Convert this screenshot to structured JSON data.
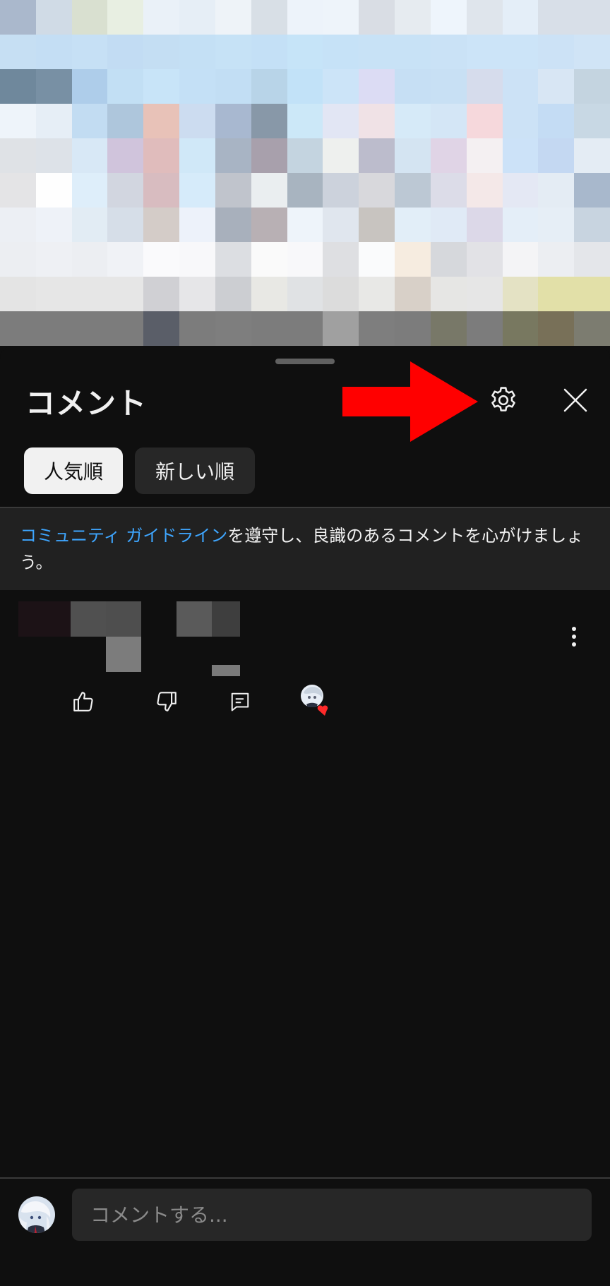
{
  "video": {
    "pixel_colors": [
      [
        "#aab8cc",
        "#d0dbe6",
        "#d9e0d0",
        "#e8efe2",
        "#eaf1f8",
        "#e6eef6",
        "#eef3f8",
        "#d8dfe6",
        "#edf3fa",
        "#eef4fa",
        "#d9dde4",
        "#e6ebf0",
        "#eef5fc",
        "#dfe5ec",
        "#e4eef8",
        "#d8dfe8",
        "#d8dfe8"
      ],
      [
        "#c6dff3",
        "#c4def4",
        "#c6e0f5",
        "#c2dcf3",
        "#c4def3",
        "#c4e0f5",
        "#c6e2f6",
        "#c4e0f6",
        "#c6e4f8",
        "#c6e2f7",
        "#c8e2f6",
        "#c8e2f6",
        "#cae2f6",
        "#cce4f8",
        "#cce4f8",
        "#cce2f6",
        "#d0e4f6"
      ],
      [
        "#6f889c",
        "#7890a4",
        "#aecdea",
        "#c2dff4",
        "#c8e4f8",
        "#c4e0f6",
        "#c2def4",
        "#b8d4e8",
        "#c2e2f8",
        "#cce4f8",
        "#dcdcf4",
        "#c6dff4",
        "#c8e0f4",
        "#d6dcec",
        "#cce2f6",
        "#d8e6f4",
        "#c4d4e0"
      ],
      [
        "#eef4fa",
        "#e6eef6",
        "#c2dcf2",
        "#aec6dc",
        "#e8c2b8",
        "#ccdcf0",
        "#a8b8d0",
        "#8898a8",
        "#cce8f8",
        "#e2e6f4",
        "#f0e2e6",
        "#d6eaf8",
        "#d4e6f6",
        "#f6d8dc",
        "#cce2f6",
        "#c4dcf4",
        "#c8d8e4"
      ],
      [
        "#dfe2e6",
        "#dde2e8",
        "#d8e8f6",
        "#d0c4dc",
        "#e0bcbc",
        "#d0e8f8",
        "#a8b4c4",
        "#a8a0ac",
        "#c4d4e0",
        "#eef0ee",
        "#bcbccc",
        "#d4e4f2",
        "#e0d4e6",
        "#f4f0f2",
        "#cce2f8",
        "#c4d8f2",
        "#e4ecf4"
      ],
      [
        "#e4e4e6",
        "#fefefe",
        "#deeefa",
        "#d2d6e0",
        "#d8bcc0",
        "#d6ebfa",
        "#c0c4cc",
        "#eaeef0",
        "#a8b4c0",
        "#ccd2dc",
        "#d8d8dc",
        "#bcc8d4",
        "#dcdce8",
        "#f4e8e8",
        "#e4e8f4",
        "#e4ecf4",
        "#a8b8cc"
      ],
      [
        "#eceff4",
        "#eef2f8",
        "#e2ecf4",
        "#d6dee8",
        "#d4ccc8",
        "#edf2fa",
        "#a8b0bc",
        "#b8b0b4",
        "#eef4fa",
        "#e0e6ee",
        "#c8c4c0",
        "#e2eef8",
        "#e0eaf6",
        "#dcd8e8",
        "#e4eef8",
        "#e6eef6",
        "#c8d4e0"
      ],
      [
        "#eceef2",
        "#eef0f4",
        "#eceef2",
        "#f0f2f6",
        "#fafafc",
        "#f8f8fa",
        "#dcdee2",
        "#fafafa",
        "#f8f8fa",
        "#dedfe2",
        "#fafbfc",
        "#f6ece0",
        "#d6d8dc",
        "#e2e2e6",
        "#f4f4f6",
        "#eceef2",
        "#e4e6ea"
      ],
      [
        "#e4e4e4",
        "#e6e6e6",
        "#e6e6e6",
        "#e6e6e6",
        "#d0d0d4",
        "#e6e6e8",
        "#ccced2",
        "#e8e8e4",
        "#e0e2e4",
        "#dcdcdc",
        "#e8e8e6",
        "#d8d0c8",
        "#e6e6e4",
        "#e6e6e6",
        "#e4e2c4",
        "#e2e0a8",
        "#e2e0a8"
      ],
      [
        "#7c7c7c",
        "#7c7c7c",
        "#7c7c7c",
        "#7c7c7c",
        "#5a5e68",
        "#7c7c7c",
        "#7e7e7e",
        "#7c7c7c",
        "#7c7c7c",
        "#a0a0a0",
        "#7e7e7e",
        "#7c7c7c",
        "#787868",
        "#7c7c7c",
        "#787860",
        "#787058",
        "#7c7c70"
      ]
    ]
  },
  "sheet": {
    "title": "コメント",
    "settings_icon": "gear-icon",
    "close_icon": "close-icon",
    "annotation_arrow_color": "#ff0000"
  },
  "chips": [
    {
      "label": "人気順",
      "selected": true
    },
    {
      "label": "新しい順",
      "selected": false
    }
  ],
  "guideline": {
    "link_text": "コミュニティ ガイドライン",
    "text": "を遵守し、良識のあるコメントを心がけましょう。",
    "link_color": "#3ea6ff"
  },
  "comment": {
    "pixel_blocks": [
      "#1c1216",
      "#1c1216",
      "#505050",
      "#505050",
      "#4e4e4e",
      "#7c7c7c",
      "#5a5a5a",
      "#3e3e3e",
      "#7a7a7a"
    ],
    "actions": [
      "like-icon",
      "dislike-icon",
      "reply-icon"
    ],
    "creator_heart_color": "#ff2a2a",
    "menu_icon": "more-vertical-icon"
  },
  "composer": {
    "placeholder": "コメントする..."
  },
  "colors": {
    "background": "#0f0f0f",
    "chip_selected_bg": "#f1f1f1",
    "chip_bg": "#272727",
    "banner_bg": "#212121"
  }
}
